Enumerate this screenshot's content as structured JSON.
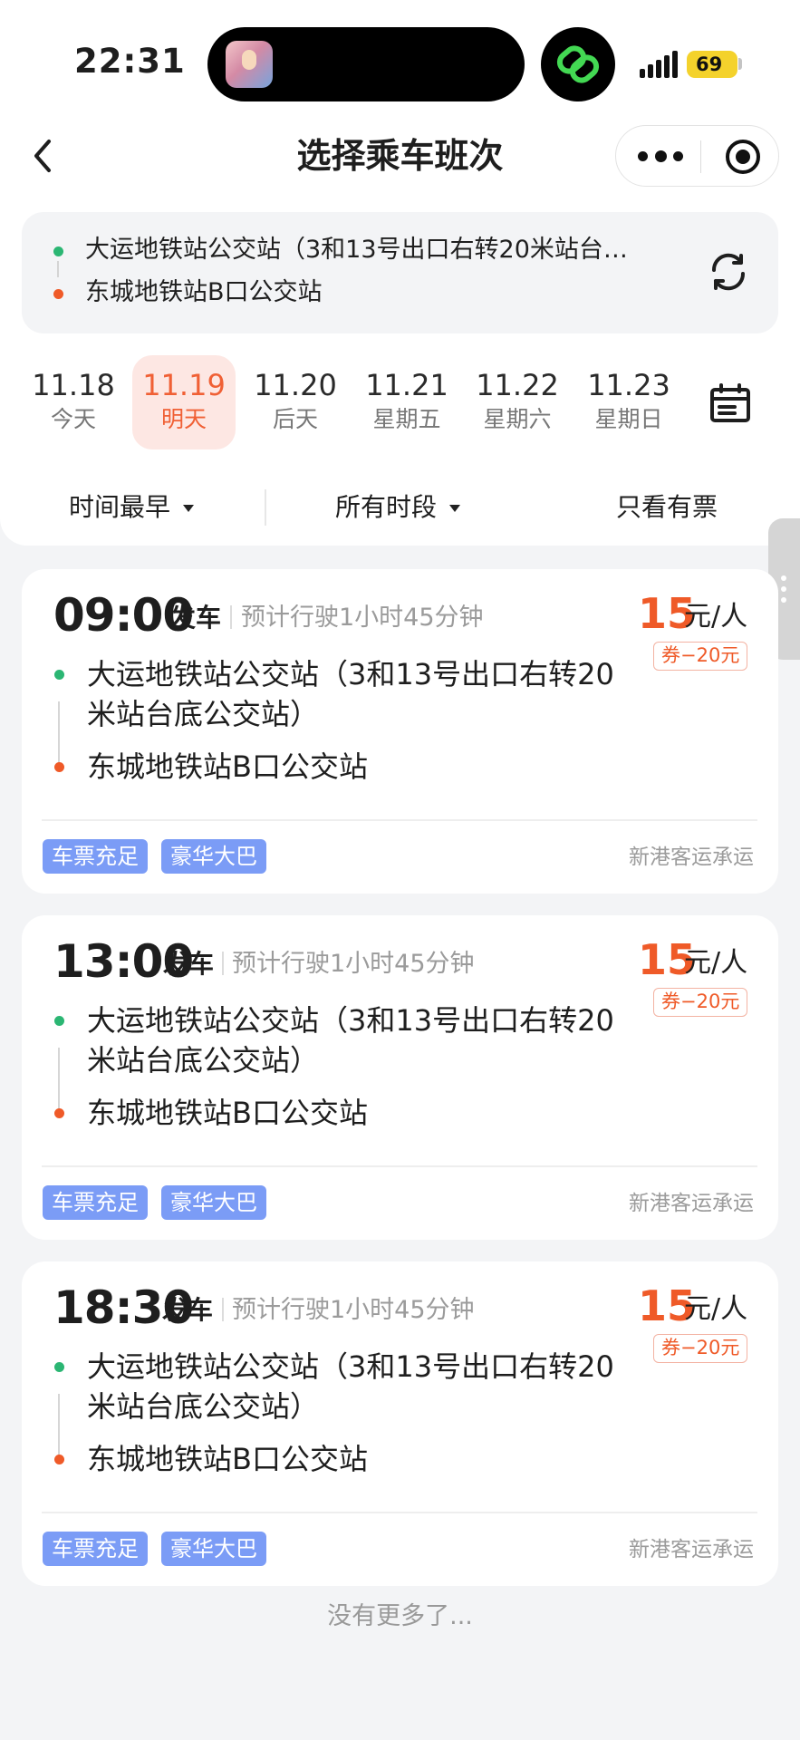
{
  "status_bar": {
    "time": "22:31",
    "battery": "69"
  },
  "nav": {
    "title": "选择乘车班次",
    "back_icon": "chevron-left-icon",
    "more_icon": "more-dots-icon",
    "target_icon": "target-icon"
  },
  "route": {
    "from": "大运地铁站公交站（3和13号出口右转20米站台…",
    "to": "东城地铁站B口公交站",
    "from_color": "#2bb673",
    "to_color": "#ef5a28",
    "swap_icon": "refresh-icon"
  },
  "dates": [
    {
      "date": "11.18",
      "label": "今天"
    },
    {
      "date": "11.19",
      "label": "明天",
      "selected": true
    },
    {
      "date": "11.20",
      "label": "后天"
    },
    {
      "date": "11.21",
      "label": "星期五"
    },
    {
      "date": "11.22",
      "label": "星期六"
    },
    {
      "date": "11.23",
      "label": "星期日"
    }
  ],
  "calendar_icon": "calendar-icon",
  "filters": {
    "sort": "时间最早",
    "period": "所有时段",
    "only_available": "只看有票"
  },
  "trips": [
    {
      "time": "09:00",
      "depart_label": "发车",
      "duration": "预计行驶1小时45分钟",
      "price": "15",
      "unit": "元/人",
      "coupon": "券−20元",
      "from_line1": "大运地铁站公交站（3和13号出口右转20",
      "from_line2": "米站台底公交站）",
      "to": "东城地铁站B口公交站",
      "tags": [
        "车票充足",
        "豪华大巴"
      ],
      "operator": "新港客运承运"
    },
    {
      "time": "13:00",
      "depart_label": "发车",
      "duration": "预计行驶1小时45分钟",
      "price": "15",
      "unit": "元/人",
      "coupon": "券−20元",
      "from_line1": "大运地铁站公交站（3和13号出口右转20",
      "from_line2": "米站台底公交站）",
      "to": "东城地铁站B口公交站",
      "tags": [
        "车票充足",
        "豪华大巴"
      ],
      "operator": "新港客运承运"
    },
    {
      "time": "18:30",
      "depart_label": "发车",
      "duration": "预计行驶1小时45分钟",
      "price": "15",
      "unit": "元/人",
      "coupon": "券−20元",
      "from_line1": "大运地铁站公交站（3和13号出口右转20",
      "from_line2": "米站台底公交站）",
      "to": "东城地铁站B口公交站",
      "tags": [
        "车票充足",
        "豪华大巴"
      ],
      "operator": "新港客运承运"
    }
  ],
  "footer": {
    "no_more": "没有更多了..."
  },
  "colors": {
    "accent": "#ef5a28",
    "tag_blue": "#7b9cf6",
    "selected_date_bg": "#fde7e3"
  }
}
